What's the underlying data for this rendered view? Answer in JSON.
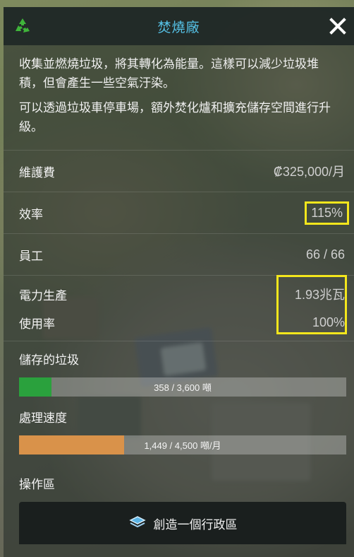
{
  "panel": {
    "title": "焚燒廠",
    "logo_icon": "recycle-icon",
    "close_icon": "close-icon",
    "title_color": "#56c3e8",
    "highlight_color": "#f4e61c"
  },
  "description": {
    "p1": "收集並燃燒垃圾，將其轉化為能量。這樣可以減少垃圾堆積，但會產生一些空氣汙染。",
    "p2": "可以透過垃圾車停車場，額外焚化爐和擴充儲存空間進行升級。"
  },
  "stats": {
    "upkeep": {
      "label": "維護費",
      "value": "₡325,000/月"
    },
    "efficiency": {
      "label": "效率",
      "value": "115%"
    },
    "workers": {
      "label": "員工",
      "value": "66 / 66"
    },
    "power": {
      "label": "電力生產",
      "value": "1.93兆瓦"
    },
    "usage": {
      "label": "使用率",
      "value": "100%"
    }
  },
  "storage": {
    "label": "儲存的垃圾",
    "text": "358 / 3,600 噸",
    "fraction": 0.0994,
    "color": "#2aa13d"
  },
  "processing": {
    "label": "處理速度",
    "text": "1,449 / 4,500 噸/月",
    "fraction": 0.322,
    "color": "#d9924a"
  },
  "operations": {
    "label": "操作區",
    "button_label": "創造一個行政區",
    "button_icon": "district-layers-icon"
  }
}
